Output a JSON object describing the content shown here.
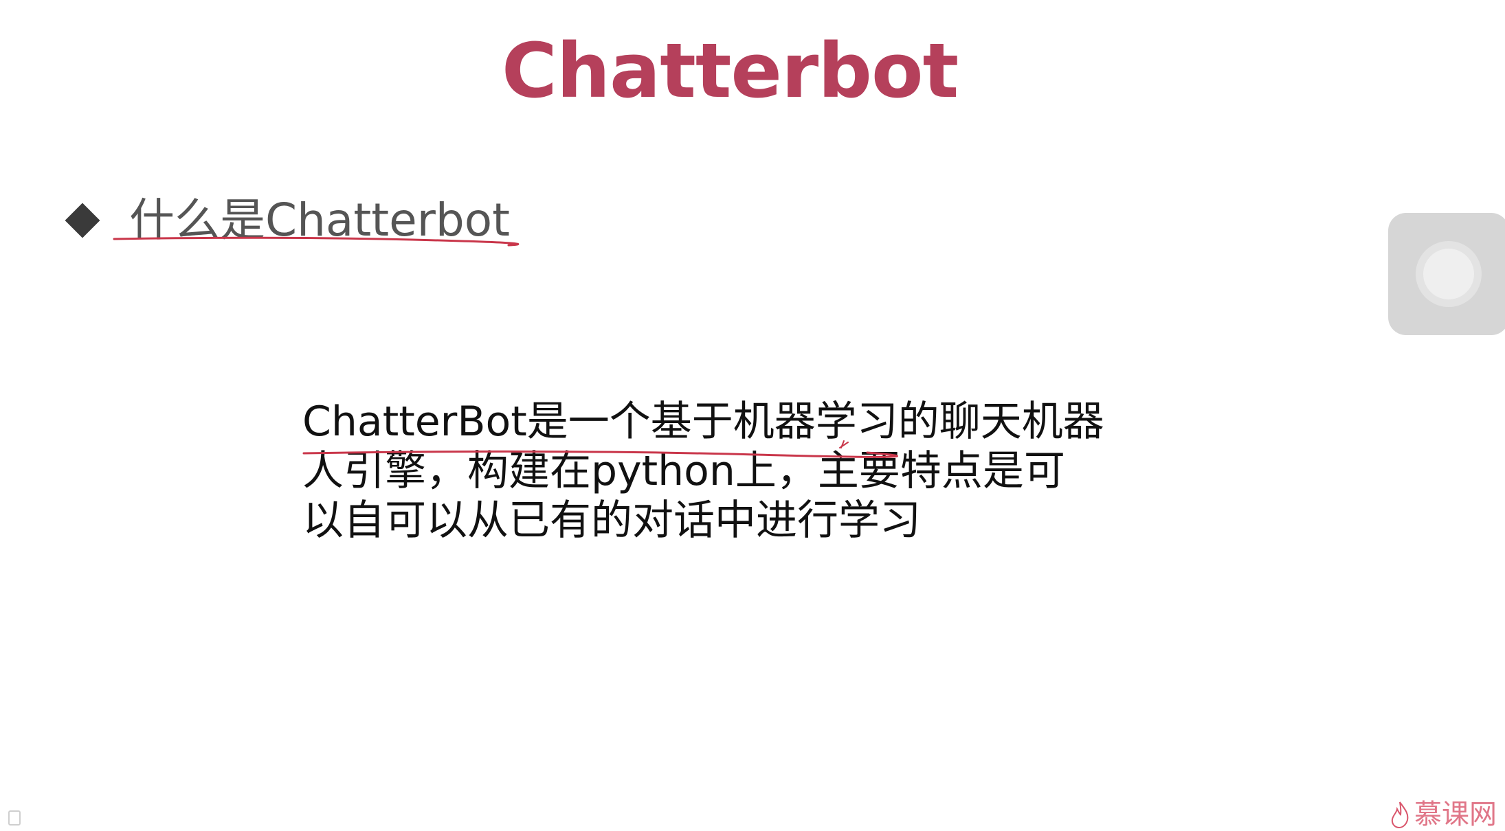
{
  "slide": {
    "title": "Chatterbot",
    "bullet": "什么是Chatterbot",
    "body_lines": [
      "ChatterBot是一个基于机器学习的聊天机器",
      "人引擎，构建在python上，主要特点是可",
      "以自可以从已有的对话中进行学习"
    ]
  },
  "logo": {
    "text": "慕课网",
    "icon": "flame-icon"
  },
  "widgets": {
    "floating_button_icon": "circle-icon",
    "corner_icon": "page-icon"
  },
  "colors": {
    "title": "#b5405b",
    "text": "#111111",
    "bullet_text": "#555555",
    "annotation": "#c9364a",
    "logo": "#d9556b",
    "background": "#ffffff"
  }
}
